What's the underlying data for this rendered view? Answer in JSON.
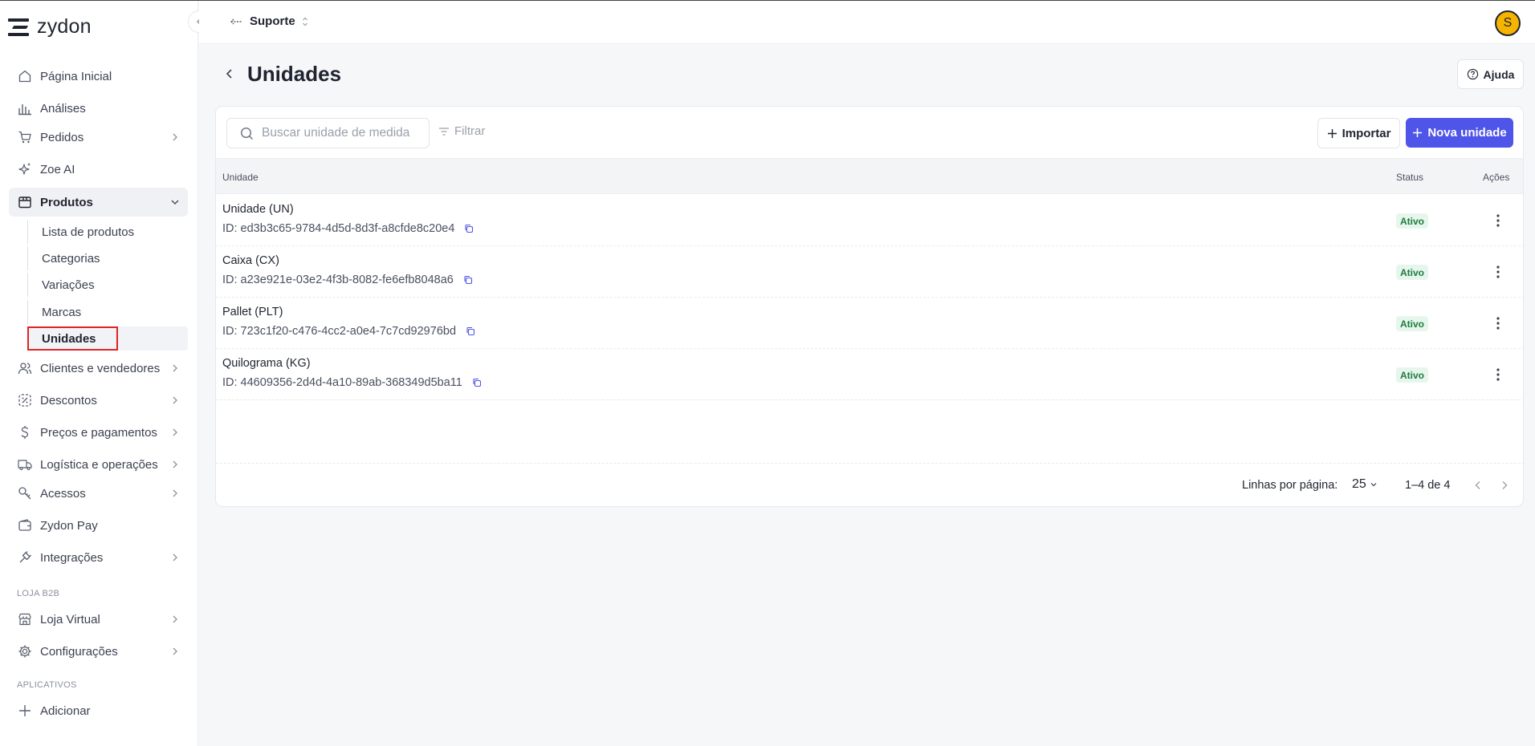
{
  "app": {
    "logo_text": "zydon"
  },
  "topbar": {
    "workspace": "Suporte",
    "avatar_initial": "S"
  },
  "sidebar": {
    "items": [
      {
        "label": "Página Inicial",
        "icon": "home-icon"
      },
      {
        "label": "Análises",
        "icon": "chart-icon"
      },
      {
        "label": "Pedidos",
        "icon": "cart-icon"
      },
      {
        "label": "Zoe AI",
        "icon": "sparkle-icon"
      },
      {
        "label": "Produtos",
        "icon": "box-icon"
      }
    ],
    "produtos_sub": [
      "Lista de produtos",
      "Categorias",
      "Variações",
      "Marcas",
      "Unidades"
    ],
    "items2": [
      {
        "label": "Clientes e vendedores",
        "icon": "users-icon"
      },
      {
        "label": "Descontos",
        "icon": "discount-icon"
      },
      {
        "label": "Preços e pagamentos",
        "icon": "dollar-icon"
      },
      {
        "label": "Logística e operações",
        "icon": "truck-icon"
      },
      {
        "label": "Acessos",
        "icon": "key-icon"
      },
      {
        "label": "Zydon Pay",
        "icon": "wallet-icon"
      },
      {
        "label": "Integrações",
        "icon": "plug-icon"
      }
    ],
    "section_b2b": "LOJA B2B",
    "items3": [
      {
        "label": "Loja Virtual",
        "icon": "store-icon"
      },
      {
        "label": "Configurações",
        "icon": "gear-icon"
      }
    ],
    "section_apps": "APLICATIVOS",
    "add_label": "Adicionar"
  },
  "page": {
    "title": "Unidades",
    "help_label": "Ajuda",
    "search_placeholder": "Buscar unidade de medida",
    "filter_label": "Filtrar",
    "import_label": "Importar",
    "new_label": "Nova unidade"
  },
  "table": {
    "headers": {
      "unit": "Unidade",
      "status": "Status",
      "actions": "Ações"
    },
    "rows": [
      {
        "name": "Unidade (UN)",
        "id": "ID: ed3b3c65-9784-4d5d-8d3f-a8cfde8c20e4",
        "status": "Ativo"
      },
      {
        "name": "Caixa (CX)",
        "id": "ID: a23e921e-03e2-4f3b-8082-fe6efb8048a6",
        "status": "Ativo"
      },
      {
        "name": "Pallet (PLT)",
        "id": "ID: 723c1f20-c476-4cc2-a0e4-7c7cd92976bd",
        "status": "Ativo"
      },
      {
        "name": "Quilograma (KG)",
        "id": "ID: 44609356-2d4d-4a10-89ab-368349d5ba11",
        "status": "Ativo"
      }
    ]
  },
  "pagination": {
    "rows_label": "Linhas por página:",
    "rows_value": "25",
    "range": "1–4 de 4"
  },
  "colors": {
    "primary": "#4f55e8",
    "active_badge_bg": "#e6f6ec",
    "active_badge_text": "#1d7a3e",
    "highlight": "#e02424"
  }
}
